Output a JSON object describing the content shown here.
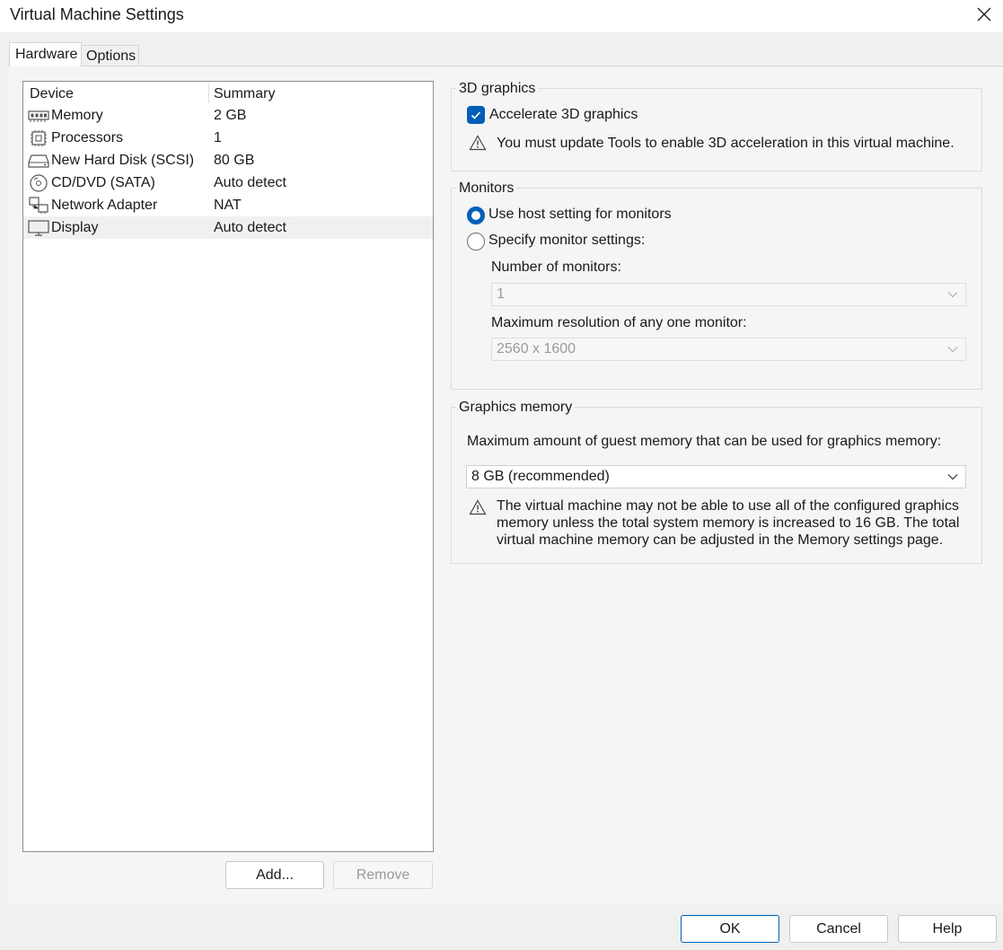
{
  "window": {
    "title": "Virtual Machine Settings"
  },
  "tabs": [
    {
      "label": "Hardware",
      "active": true
    },
    {
      "label": "Options",
      "active": false
    }
  ],
  "device_list": {
    "headers": {
      "device": "Device",
      "summary": "Summary"
    },
    "rows": [
      {
        "icon": "memory-icon",
        "name": "Memory",
        "summary": "2 GB"
      },
      {
        "icon": "processor-icon",
        "name": "Processors",
        "summary": "1"
      },
      {
        "icon": "hard-disk-icon",
        "name": "New Hard Disk (SCSI)",
        "summary": "80 GB"
      },
      {
        "icon": "cd-dvd-icon",
        "name": "CD/DVD (SATA)",
        "summary": "Auto detect"
      },
      {
        "icon": "network-adapter-icon",
        "name": "Network Adapter",
        "summary": "NAT"
      },
      {
        "icon": "display-icon",
        "name": "Display",
        "summary": "Auto detect",
        "selected": true
      }
    ]
  },
  "list_buttons": {
    "add": "Add...",
    "remove": "Remove"
  },
  "graphics_3d": {
    "title": "3D graphics",
    "accelerate_label": "Accelerate 3D graphics",
    "accelerate_checked": true,
    "warning": "You must update Tools to enable 3D acceleration in this virtual machine."
  },
  "monitors": {
    "title": "Monitors",
    "use_host_label": "Use host setting for monitors",
    "specify_label": "Specify monitor settings:",
    "selected_option": "use_host",
    "number_label": "Number of monitors:",
    "number_value": "1",
    "resolution_label": "Maximum resolution of any one monitor:",
    "resolution_value": "2560 x 1600"
  },
  "graphics_memory": {
    "title": "Graphics memory",
    "label": "Maximum amount of guest memory that can be used for graphics memory:",
    "value": "8 GB (recommended)",
    "warning_lines": [
      "The virtual machine may not be able to use all of the configured graphics",
      "memory unless the total system memory is increased to 16 GB. The total",
      "virtual machine memory can be adjusted in the Memory settings page."
    ]
  },
  "dialog_buttons": {
    "ok": "OK",
    "cancel": "Cancel",
    "help": "Help"
  },
  "colors": {
    "accent": "#005fb8",
    "background": "#f0f0f0",
    "panel": "#f5f5f5"
  }
}
